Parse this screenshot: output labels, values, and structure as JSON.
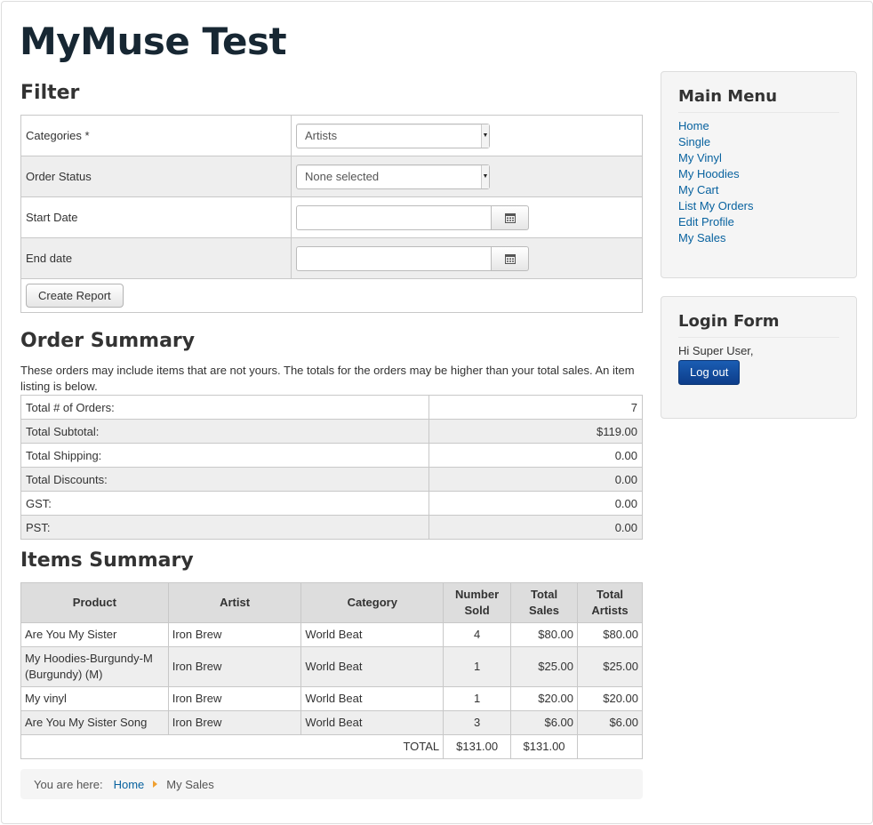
{
  "site_title": "MyMuse Test",
  "filter": {
    "heading": "Filter",
    "categories_label": "Categories *",
    "categories_value": "Artists",
    "order_status_label": "Order Status",
    "order_status_value": "None selected",
    "start_date_label": "Start Date",
    "start_date_value": "",
    "end_date_label": "End date",
    "end_date_value": "",
    "create_report_label": "Create Report"
  },
  "order_summary": {
    "heading": "Order Summary",
    "description": "These orders may include items that are not yours. The totals for the orders may be higher than your total sales. An item listing is below.",
    "rows": [
      {
        "label": "Total # of Orders:",
        "value": "7"
      },
      {
        "label": "Total Subtotal:",
        "value": "$119.00"
      },
      {
        "label": "Total Shipping:",
        "value": "0.00"
      },
      {
        "label": "Total Discounts:",
        "value": "0.00"
      },
      {
        "label": "GST:",
        "value": "0.00"
      },
      {
        "label": "PST:",
        "value": "0.00"
      }
    ]
  },
  "items_summary": {
    "heading": "Items Summary",
    "columns": [
      "Product",
      "Artist",
      "Category",
      "Number Sold",
      "Total Sales",
      "Total Artists"
    ],
    "rows": [
      {
        "product": "Are You My Sister",
        "artist": "Iron Brew",
        "category": "World Beat",
        "sold": "4",
        "sales": "$80.00",
        "artists": "$80.00"
      },
      {
        "product": "My Hoodies-Burgundy-M (Burgundy) (M)",
        "artist": "Iron Brew",
        "category": "World Beat",
        "sold": "1",
        "sales": "$25.00",
        "artists": "$25.00"
      },
      {
        "product": "My vinyl",
        "artist": "Iron Brew",
        "category": "World Beat",
        "sold": "1",
        "sales": "$20.00",
        "artists": "$20.00"
      },
      {
        "product": "Are You My Sister Song",
        "artist": "Iron Brew",
        "category": "World Beat",
        "sold": "3",
        "sales": "$6.00",
        "artists": "$6.00"
      }
    ],
    "total_label": "TOTAL",
    "total_sold": "$131.00",
    "total_sales": "$131.00"
  },
  "breadcrumb": {
    "prefix": "You are here:",
    "home": "Home",
    "current": "My Sales"
  },
  "main_menu": {
    "heading": "Main Menu",
    "items": [
      "Home",
      "Single",
      "My Vinyl",
      "My Hoodies",
      "My Cart",
      "List My Orders",
      "Edit Profile",
      "My Sales"
    ]
  },
  "login_form": {
    "heading": "Login Form",
    "greeting": "Hi Super User,",
    "logout_label": "Log out"
  },
  "colors": {
    "link": "#08629f",
    "primary_button": "#0d4a9e",
    "title": "#172733"
  },
  "icons": {
    "calendar": "calendar-icon",
    "dropdown": "chevron-down-icon",
    "breadcrumb_separator": "triangle-right-icon"
  }
}
